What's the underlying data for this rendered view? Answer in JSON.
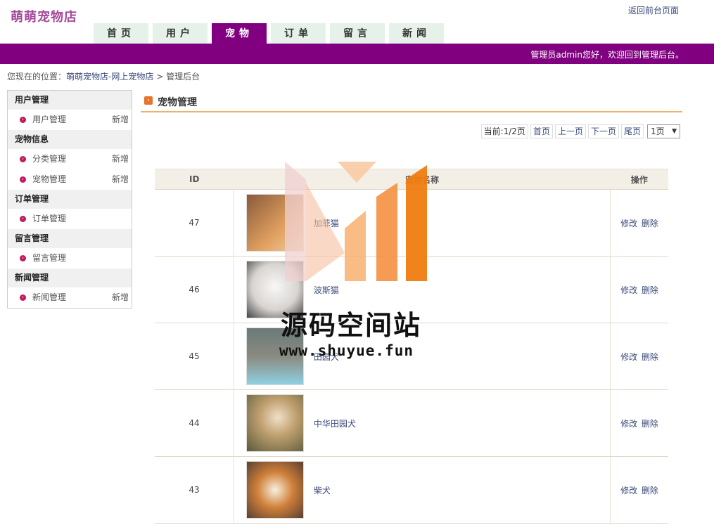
{
  "header": {
    "logo": "萌萌宠物店",
    "top_link": "返回前台页面",
    "welcome": "管理员admin您好，欢迎回到管理后台。"
  },
  "nav": {
    "tabs": [
      {
        "label": "首页",
        "active": false
      },
      {
        "label": "用户",
        "active": false
      },
      {
        "label": "宠物",
        "active": true
      },
      {
        "label": "订单",
        "active": false
      },
      {
        "label": "留言",
        "active": false
      },
      {
        "label": "新闻",
        "active": false
      }
    ]
  },
  "breadcrumb": {
    "prefix": "您现在的位置：",
    "link": "萌萌宠物店-网上宠物店",
    "sep": ">",
    "current": "管理后台"
  },
  "sidebar": {
    "sections": [
      {
        "title": "用户管理",
        "items": [
          {
            "label": "用户管理",
            "add": "新增"
          }
        ]
      },
      {
        "title": "宠物信息",
        "items": [
          {
            "label": "分类管理",
            "add": "新增"
          },
          {
            "label": "宠物管理",
            "add": "新增"
          }
        ]
      },
      {
        "title": "订单管理",
        "items": [
          {
            "label": "订单管理",
            "add": ""
          }
        ]
      },
      {
        "title": "留言管理",
        "items": [
          {
            "label": "留言管理",
            "add": ""
          }
        ]
      },
      {
        "title": "新闻管理",
        "items": [
          {
            "label": "新闻管理",
            "add": "新增"
          }
        ]
      }
    ]
  },
  "main": {
    "title": "宠物管理",
    "pager": {
      "current": "当前:1/2页",
      "first": "首页",
      "prev": "上一页",
      "next": "下一页",
      "last": "尾页",
      "select_value": "1页"
    },
    "table": {
      "headers": {
        "id": "ID",
        "name": "宠物名称",
        "ops": "操作"
      },
      "edit_label": "修改",
      "delete_label": "删除",
      "rows": [
        {
          "id": "47",
          "name": "加菲猫",
          "thumb_color": "#c98a4a"
        },
        {
          "id": "46",
          "name": "波斯猫",
          "thumb_color": "#d8d4d0"
        },
        {
          "id": "45",
          "name": "田园犬",
          "thumb_color": "#7fb7c4"
        },
        {
          "id": "44",
          "name": "中华田园犬",
          "thumb_color": "#8a7a5a"
        },
        {
          "id": "43",
          "name": "柴犬",
          "thumb_color": "#c77b3a"
        }
      ]
    }
  },
  "watermark": {
    "title": "源码空间站",
    "url": "www.shuyue.fun"
  }
}
